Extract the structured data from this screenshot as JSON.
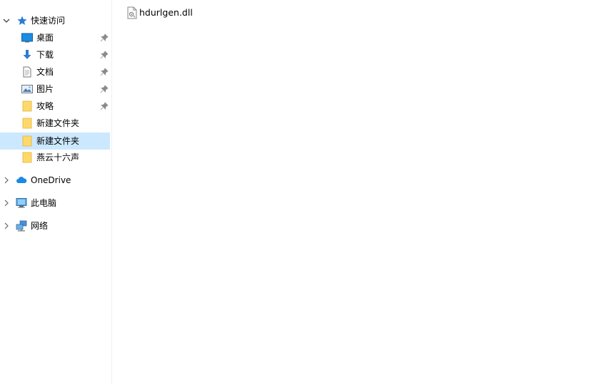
{
  "nav": {
    "quick_access": "快速访问",
    "pinned": [
      {
        "label": "桌面",
        "icon": "desktop-icon"
      },
      {
        "label": "下载",
        "icon": "download-icon"
      },
      {
        "label": "文档",
        "icon": "document-icon"
      },
      {
        "label": "图片",
        "icon": "pictures-icon"
      },
      {
        "label": "攻略",
        "icon": "folder-icon"
      }
    ],
    "recent": [
      {
        "label": "新建文件夹",
        "icon": "folder-icon",
        "selected": false
      },
      {
        "label": "新建文件夹",
        "icon": "folder-icon",
        "selected": true
      },
      {
        "label": "燕云十六声",
        "icon": "folder-icon",
        "selected": false
      }
    ],
    "onedrive": "OneDrive",
    "this_pc": "此电脑",
    "network": "网络"
  },
  "content": {
    "files": [
      {
        "name": "hdurlgen.dll",
        "icon": "dll-file-icon"
      }
    ]
  },
  "colors": {
    "selection": "#cce8ff",
    "folder": "#ffd86a",
    "accent": "#1e88e5"
  }
}
